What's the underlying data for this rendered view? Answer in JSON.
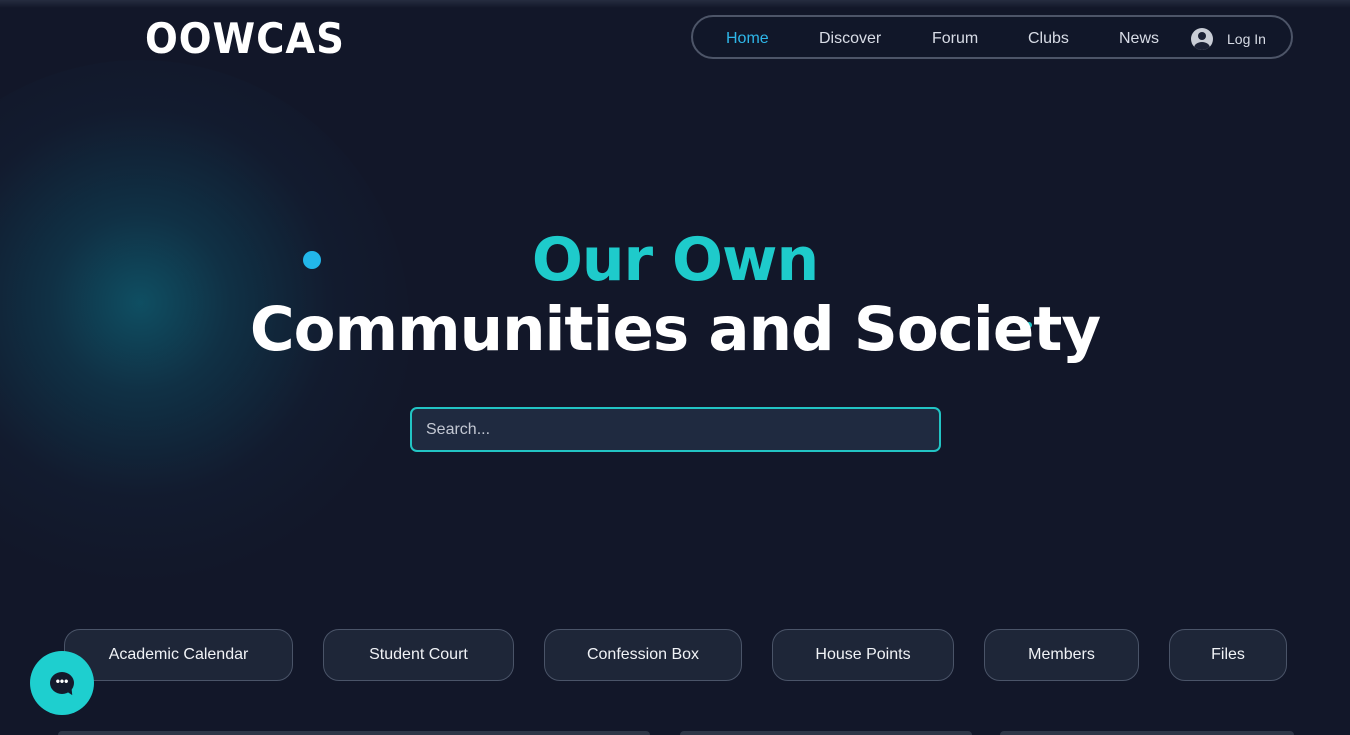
{
  "brand": {
    "logo_text": "OOWCAS"
  },
  "nav": {
    "items": [
      {
        "label": "Home",
        "active": true
      },
      {
        "label": "Discover",
        "active": false
      },
      {
        "label": "Forum",
        "active": false
      },
      {
        "label": "Clubs",
        "active": false
      },
      {
        "label": "News",
        "active": false
      }
    ],
    "login_label": "Log In",
    "login_icon": "user-avatar-icon"
  },
  "hero": {
    "line1": "Our Own",
    "line2": "Communities and Society"
  },
  "search": {
    "placeholder": "Search..."
  },
  "quick_links": [
    {
      "label": "Academic Calendar"
    },
    {
      "label": "Student Court"
    },
    {
      "label": "Confession Box"
    },
    {
      "label": "House Points"
    },
    {
      "label": "Members"
    },
    {
      "label": "Files"
    }
  ],
  "chat": {
    "icon": "chat-bubble-icon",
    "glyph": "•••"
  },
  "colors": {
    "background": "#121729",
    "accent_teal": "#1ecbcb",
    "accent_blue": "#2eb6e8",
    "pill_background": "#1e2638"
  }
}
